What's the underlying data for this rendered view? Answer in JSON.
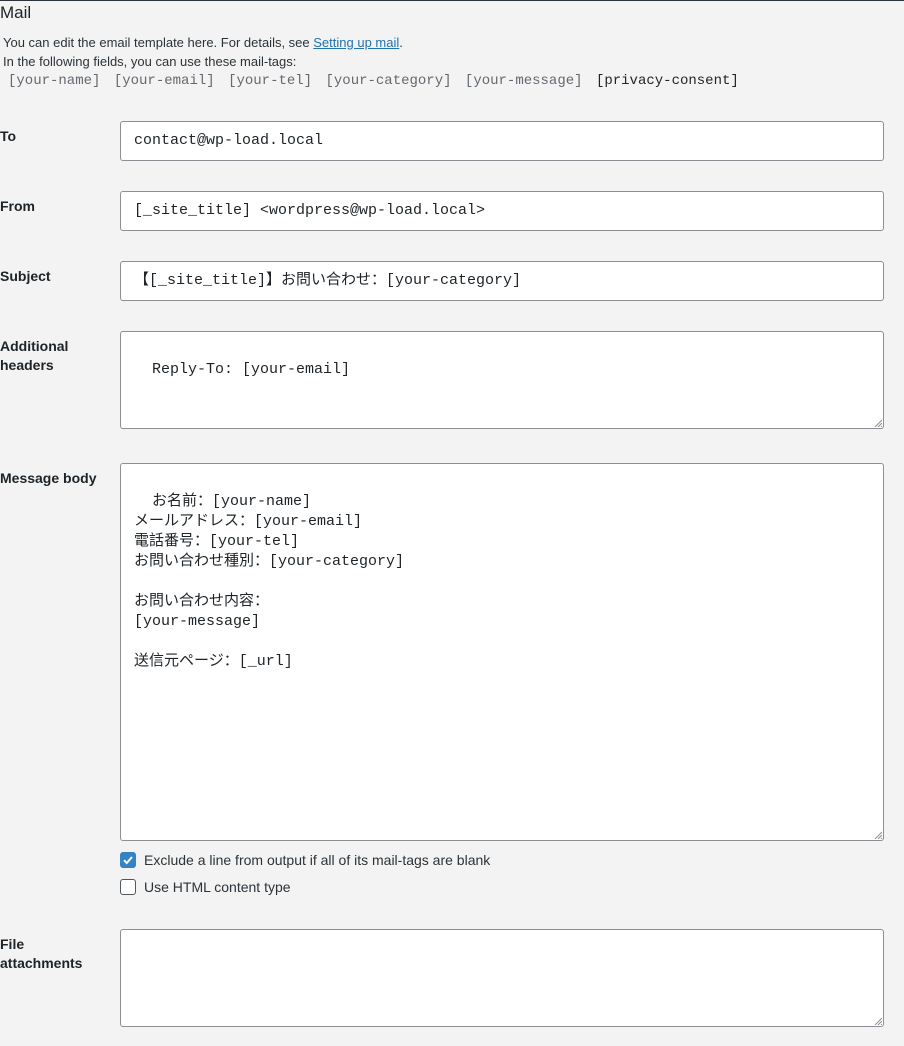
{
  "section": {
    "title": "Mail",
    "intro_prefix": "You can edit the email template here. For details, see ",
    "intro_link": "Setting up mail",
    "intro_suffix": ".",
    "tags_intro": "In the following fields, you can use these mail-tags:",
    "mail_tags": [
      "[your-name]",
      "[your-email]",
      "[your-tel]",
      "[your-category]",
      "[your-message]"
    ],
    "mail_tag_required": "[privacy-consent]"
  },
  "fields": {
    "to": {
      "label": "To",
      "value": "contact@wp-load.local"
    },
    "from": {
      "label": "From",
      "value": "[_site_title] <wordpress@wp-load.local>"
    },
    "subject": {
      "label": "Subject",
      "value": "【[_site_title]】お問い合わせ：[your-category]"
    },
    "additional_headers": {
      "label": "Additional headers",
      "value": "Reply-To: [your-email]"
    },
    "message_body": {
      "label": "Message body",
      "value": "お名前：[your-name]\nメールアドレス：[your-email]\n電話番号：[your-tel]\nお問い合わせ種別：[your-category]\n\nお問い合わせ内容：\n[your-message]\n\n送信元ページ：[_url]"
    },
    "file_attachments": {
      "label": "File attachments",
      "value": ""
    }
  },
  "options": {
    "exclude_blank": {
      "label": "Exclude a line from output if all of its mail-tags are blank",
      "checked": true
    },
    "use_html": {
      "label": "Use HTML content type",
      "checked": false
    }
  },
  "colors": {
    "accent": "#3582c4",
    "link": "#2271b1",
    "background": "#f3f3f3",
    "border": "#8c8f94"
  }
}
